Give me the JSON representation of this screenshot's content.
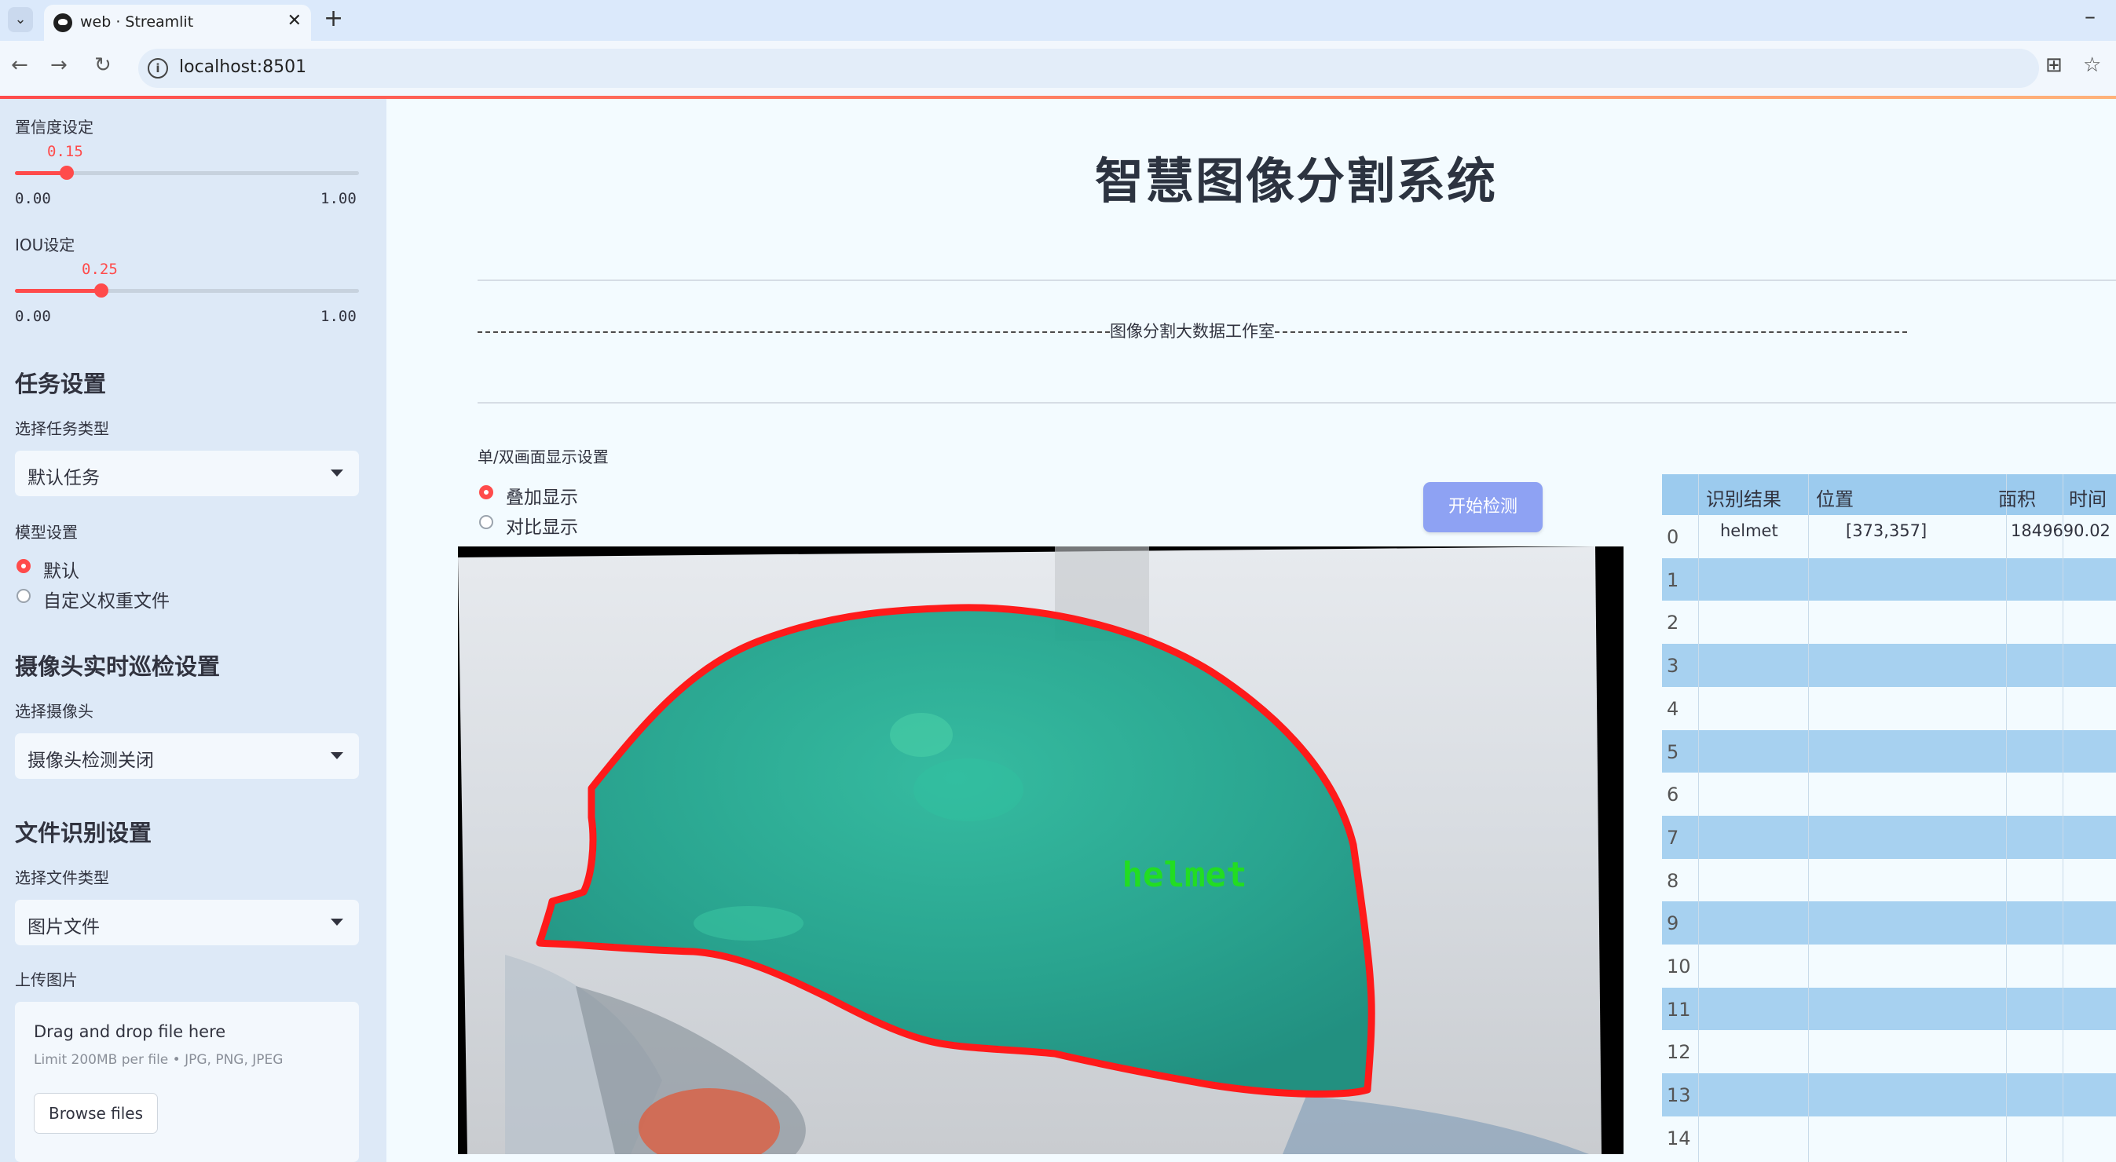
{
  "browser": {
    "tab_title": "web · Streamlit",
    "url": "localhost:8501"
  },
  "sidebar": {
    "confidence": {
      "label": "置信度设定",
      "value": "0.15",
      "value_num": 0.15,
      "min": "0.00",
      "max": "1.00"
    },
    "iou": {
      "label": "IOU设定",
      "value": "0.25",
      "value_num": 0.25,
      "min": "0.00",
      "max": "1.00"
    },
    "task": {
      "heading": "任务设置",
      "label": "选择任务类型",
      "selected": "默认任务"
    },
    "model": {
      "label": "模型设置",
      "options": [
        "默认",
        "自定义权重文件"
      ],
      "selected_index": 0
    },
    "camera": {
      "heading": "摄像头实时巡检设置",
      "label": "选择摄像头",
      "selected": "摄像头检测关闭"
    },
    "file": {
      "heading": "文件识别设置",
      "label": "选择文件类型",
      "selected": "图片文件"
    },
    "upload": {
      "label": "上传图片",
      "drop_text": "Drag and drop file here",
      "limit_text": "Limit 200MB per file • JPG, PNG, JPEG",
      "browse_label": "Browse files"
    }
  },
  "main": {
    "title": "智慧图像分割系统",
    "divider_label": "图像分割大数据工作室",
    "display_mode": {
      "label": "单/双画面显示设置",
      "options": [
        "叠加显示",
        "对比显示"
      ],
      "selected_index": 0
    },
    "start_button": "开始检测",
    "detection_label": "helmet"
  },
  "results_table": {
    "columns": [
      "识别结果",
      "位置",
      "面积",
      "时间"
    ],
    "rows": [
      {
        "index": "0",
        "result": "helmet",
        "position": "[373,357]",
        "area": "1849690.02",
        "time": ""
      },
      {
        "index": "1"
      },
      {
        "index": "2"
      },
      {
        "index": "3"
      },
      {
        "index": "4"
      },
      {
        "index": "5"
      },
      {
        "index": "6"
      },
      {
        "index": "7"
      },
      {
        "index": "8"
      },
      {
        "index": "9"
      },
      {
        "index": "10"
      },
      {
        "index": "11"
      },
      {
        "index": "12"
      },
      {
        "index": "13"
      },
      {
        "index": "14"
      }
    ]
  },
  "colors": {
    "accent": "#ff4b4b",
    "button": "#8ea2f3",
    "mask": "#1aa88a",
    "contour": "#ff1a1a",
    "label_text": "#22dd22"
  }
}
